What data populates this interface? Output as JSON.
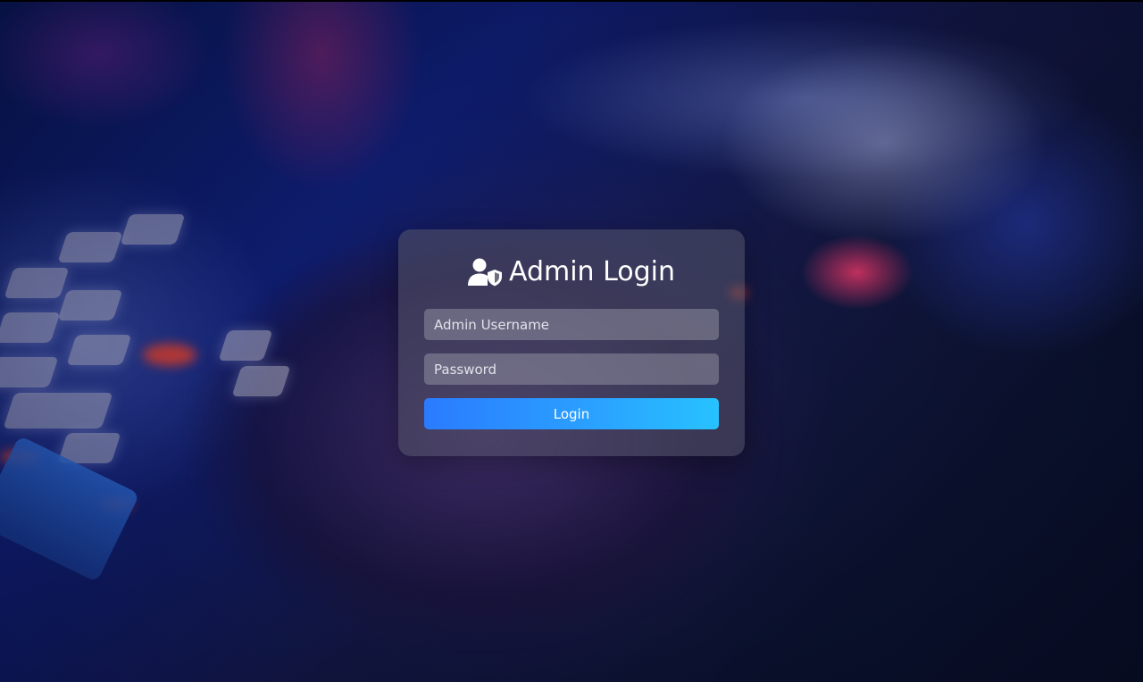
{
  "login": {
    "title": "Admin Login",
    "title_icon": "user-shield-icon",
    "username_placeholder": "Admin Username",
    "password_placeholder": "Password",
    "submit_label": "Login"
  },
  "colors": {
    "button_start": "#2a7bff",
    "button_end": "#27c2ff",
    "title_text": "#ffffff"
  }
}
